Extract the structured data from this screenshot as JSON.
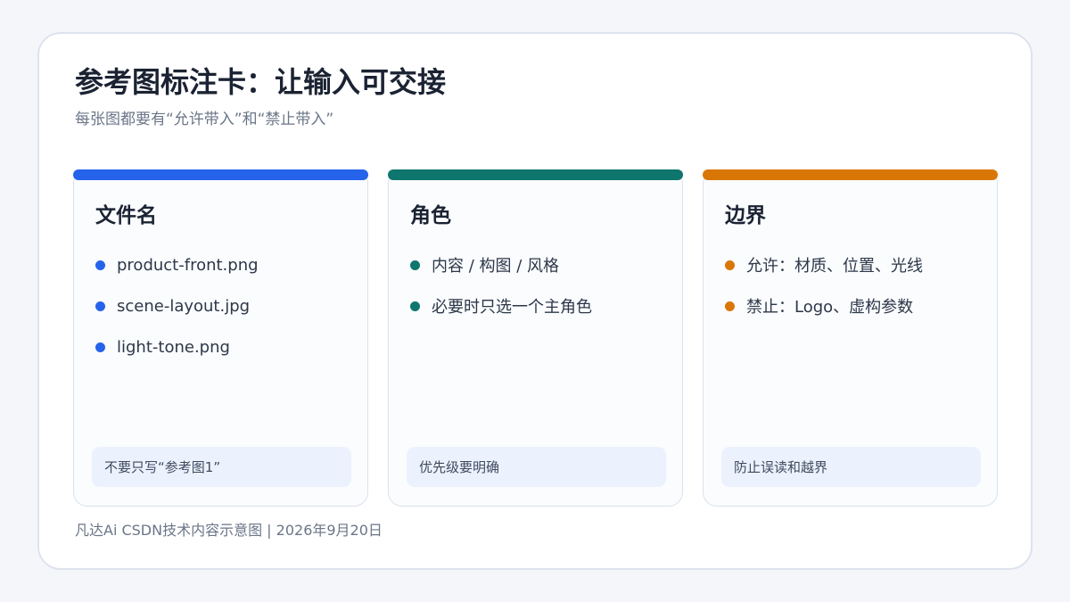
{
  "header": {
    "title": "参考图标注卡：让输入可交接",
    "subtitle": "每张图都要有“允许带入”和“禁止带入”"
  },
  "panels": [
    {
      "accent": "#2563eb",
      "title": "文件名",
      "items": [
        "product-front.png",
        "scene-layout.jpg",
        "light-tone.png"
      ],
      "note": "不要只写“参考图1”"
    },
    {
      "accent": "#0f766e",
      "title": "角色",
      "items": [
        "内容 / 构图 / 风格",
        "必要时只选一个主角色"
      ],
      "note": "优先级要明确"
    },
    {
      "accent": "#d97706",
      "title": "边界",
      "items": [
        "允许：材质、位置、光线",
        "禁止：Logo、虚构参数"
      ],
      "note": "防止误读和越界"
    }
  ],
  "footer": "凡达Ai CSDN技术内容示意图 | 2026年9月20日"
}
